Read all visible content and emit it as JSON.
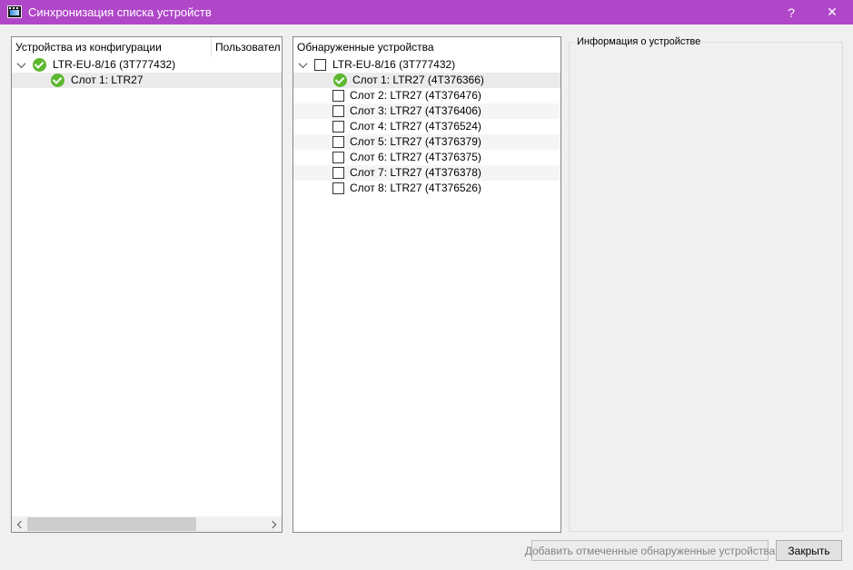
{
  "window": {
    "title": "Синхронизация списка устройств",
    "help_label": "?",
    "close_label": "✕"
  },
  "config_panel": {
    "columns": [
      "Устройства из конфигурации",
      "Пользовател"
    ],
    "root": {
      "label": "LTR-EU-8/16 (3T777432)",
      "status": "ok"
    },
    "children": [
      {
        "label": "Слот  1: LTR27",
        "status": "ok"
      }
    ]
  },
  "detected_panel": {
    "column": "Обнаруженные устройства",
    "root": {
      "label": "LTR-EU-8/16 (3T777432)",
      "checked": false
    },
    "children": [
      {
        "label": "Слот  1: LTR27 (4T376366)",
        "status": "ok"
      },
      {
        "label": "Слот  2: LTR27 (4T376476)",
        "checked": false
      },
      {
        "label": "Слот  3: LTR27 (4T376406)",
        "checked": false
      },
      {
        "label": "Слот  4: LTR27 (4T376524)",
        "checked": false
      },
      {
        "label": "Слот  5: LTR27 (4T376379)",
        "checked": false
      },
      {
        "label": "Слот  6: LTR27 (4T376375)",
        "checked": false
      },
      {
        "label": "Слот  7: LTR27 (4T376378)",
        "checked": false
      },
      {
        "label": "Слот  8: LTR27 (4T376526)",
        "checked": false
      }
    ]
  },
  "info_group": {
    "title": "Информация о устройстве"
  },
  "buttons": {
    "add_label": "Добавить отмеченные обнаруженные устройства",
    "close_label": "Закрыть"
  },
  "colors": {
    "titlebar": "#b047c9",
    "ok_green": "#5cb82e"
  }
}
